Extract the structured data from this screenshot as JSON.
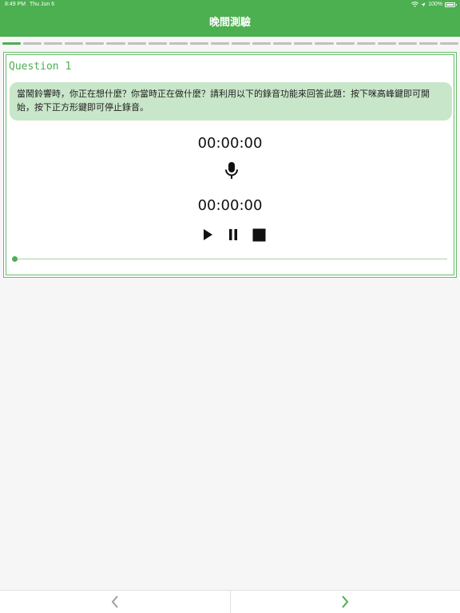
{
  "status_bar": {
    "time": "8:49 PM",
    "date": "Thu Jun 6",
    "battery": "100%"
  },
  "header": {
    "title": "晚間測驗"
  },
  "progress": {
    "total_segments": 22,
    "current": 1
  },
  "question": {
    "label": "Question 1",
    "text": "當鬧鈴響時，你正在想什麼？你當時正在做什麼？請利用以下的錄音功能來回答此題：按下咪高峰鍵即可開始，按下正方形鍵即可停止錄音。"
  },
  "recorder": {
    "record_time": "00:00:00",
    "playback_time": "00:00:00",
    "playback_position": 0,
    "icons": {
      "record": "microphone-icon",
      "play": "play-icon",
      "pause": "pause-icon",
      "stop": "stop-icon"
    }
  },
  "footer": {
    "prev_icon": "chevron-left-icon",
    "next_icon": "chevron-right-icon"
  },
  "colors": {
    "accent": "#4caf50",
    "bubble": "#c8e6c9",
    "disabled": "#9e9e9e"
  }
}
